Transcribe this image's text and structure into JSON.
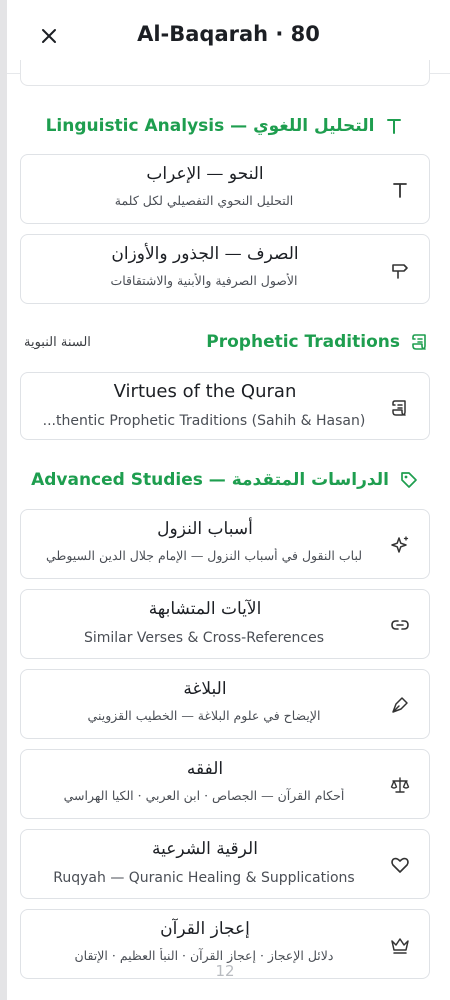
{
  "header": {
    "title": "Al-Baqarah · 80",
    "close_icon": "close-icon"
  },
  "sections": {
    "linguistic": {
      "title": "Linguistic Analysis — التحليل اللغوي",
      "icon": "text-icon"
    },
    "prophetic": {
      "title": "Prophetic Traditions",
      "subtitle": "السنة النبوية",
      "icon": "scroll-icon"
    },
    "advanced": {
      "title": "Advanced Studies — الدراسات المتقدمة",
      "icon": "tag-icon"
    }
  },
  "cards": {
    "nahw": {
      "title": "النحو — الإعراب",
      "subtitle": "التحليل النحوي التفصيلي لكل كلمة",
      "icon": "text-icon"
    },
    "sarf": {
      "title": "الصرف — الجذور والأوزان",
      "subtitle": "الأصول الصرفية والأبنية والاشتقاقات",
      "icon": "signpost-icon"
    },
    "virtues": {
      "title": "Virtues of the Quran",
      "subtitle": "...thentic Prophetic Traditions (Sahih & Hasan)",
      "icon": "scroll-icon"
    },
    "asbab": {
      "title": "أسباب النزول",
      "subtitle": "لباب النقول في أسباب النزول — الإمام جلال الدين السيوطي",
      "icon": "sparkles-icon"
    },
    "mutashabih": {
      "title": "الآيات المتشابهة",
      "subtitle": "Similar Verses & Cross-References",
      "icon": "link-icon"
    },
    "balagha": {
      "title": "البلاغة",
      "subtitle": "الإيضاح في علوم البلاغة — الخطيب القزويني",
      "icon": "pen-nib-icon"
    },
    "fiqh": {
      "title": "الفقه",
      "subtitle": "أحكام القرآن — الجصاص · ابن العربي · الكيا الهراسي",
      "icon": "scale-icon"
    },
    "ruqyah": {
      "title": "الرقية الشرعية",
      "subtitle": "Ruqyah — Quranic Healing & Supplications",
      "icon": "heart-icon"
    },
    "ijaz": {
      "title": "إعجاز القرآن",
      "subtitle": "دلائل الإعجاز · إعجاز القرآن · النبأ العظيم · الإتقان",
      "icon": "crown-icon"
    }
  },
  "page_number": "12",
  "colors": {
    "accent_green": "#1e9e4f",
    "border": "#dfe2e6",
    "text": "#1c1f24"
  }
}
